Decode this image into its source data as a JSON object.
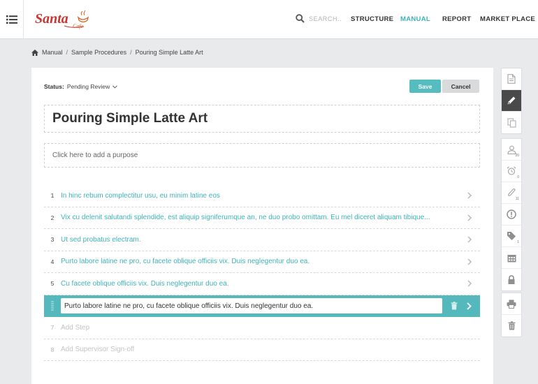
{
  "header": {
    "logo_text": "Santa Cafe",
    "search_placeholder": "SEARCH...",
    "nav": [
      "STRUCTURE",
      "MANUAL",
      "REPORT",
      "MARKET PLACE"
    ],
    "active_nav": "MANUAL"
  },
  "breadcrumb": [
    "Manual",
    "Sample Procedures",
    "Pouring Simple Latte Art"
  ],
  "status": {
    "label": "Status:",
    "value": "Pending Review"
  },
  "buttons": {
    "save": "Save",
    "cancel": "Cancel"
  },
  "title": "Pouring Simple Latte Art",
  "purpose_placeholder": "Click here to add a purpose",
  "steps": [
    {
      "num": "1",
      "text": "In hinc rebum complectitur usu, eu minim latine eos"
    },
    {
      "num": "2",
      "text": "Vix cu delenit salutandi splendide, est aliquip signiferumque an, ne duo probo omittam. Eu mel diceret aliquam tibique..."
    },
    {
      "num": "3",
      "text": "Ut sed probatus electram."
    },
    {
      "num": "4",
      "text": "Purto labore latine ne pro, cu facete oblique officiis vix. Duis neglegentur duo ea."
    },
    {
      "num": "5",
      "text": "Cu facete oblique officiis vix. Duis neglegentur duo ea."
    }
  ],
  "editing_step": {
    "value": "Purto labore latine ne pro, cu facete oblique officiis vix. Duis neglegentur duo ea."
  },
  "add_items": [
    {
      "num": "7",
      "text": "Add Step"
    },
    {
      "num": "8",
      "text": "Add Supervisor Sign-off"
    }
  ],
  "toolbar_badges": {
    "users": "20",
    "alarm": "0",
    "attachments": "11",
    "tags": "1"
  },
  "colors": {
    "accent": "#3fb3b8",
    "accent_bg": "#55b8bd",
    "active_tool": "#4a4a4a",
    "logo_red": "#c8342f"
  }
}
